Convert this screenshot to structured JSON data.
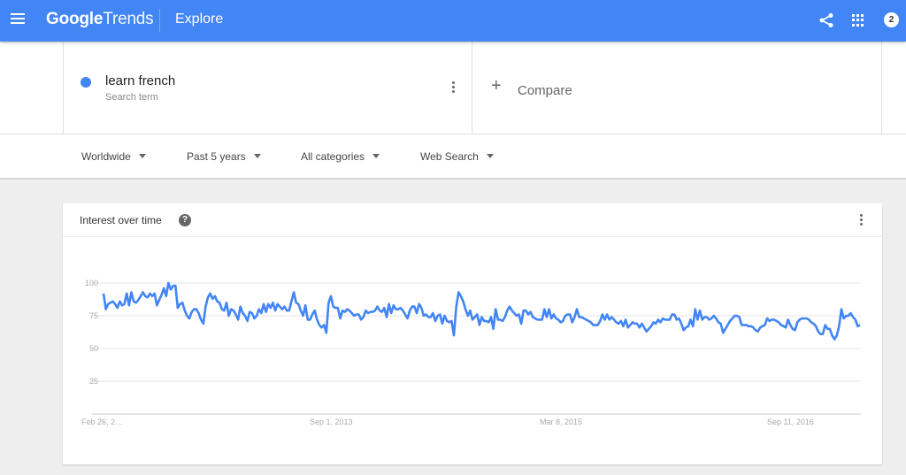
{
  "header": {
    "logo_google": "Google",
    "logo_trends": "Trends",
    "section": "Explore",
    "notification_count": "2",
    "icons": [
      "menu-icon",
      "share-icon",
      "apps-icon"
    ]
  },
  "search": {
    "term": "learn french",
    "term_type": "Search term",
    "term_color": "#4285f4",
    "compare_plus": "+",
    "compare_label": "Compare"
  },
  "filters": {
    "location": "Worldwide",
    "time_range": "Past 5 years",
    "category": "All categories",
    "search_type": "Web Search"
  },
  "card": {
    "title": "Interest over time",
    "help": "?"
  },
  "chart_data": {
    "type": "line",
    "title": "Interest over time",
    "xlabel": "",
    "ylabel": "",
    "ylim": [
      0,
      100
    ],
    "yticks": [
      25,
      50,
      75,
      100
    ],
    "ytick_labels": [
      "25",
      "50",
      "75",
      "100"
    ],
    "xtick_labels": [
      "Feb 26, 2…",
      "Sep 1, 2013",
      "Mar 8, 2015",
      "Sep 11, 2016"
    ],
    "xtick_positions": [
      0,
      0.3,
      0.6,
      0.9
    ],
    "grid": true,
    "legend": "none",
    "series": [
      {
        "name": "learn french",
        "color": "#4285f4",
        "values": [
          92,
          80,
          84,
          85,
          86,
          84,
          81,
          86,
          83,
          84,
          92,
          83,
          93,
          86,
          85,
          87,
          90,
          93,
          90,
          89,
          92,
          90,
          92,
          83,
          87,
          91,
          96,
          90,
          100,
          95,
          98,
          98,
          81,
          84,
          85,
          79,
          75,
          73,
          78,
          80,
          80,
          77,
          72,
          69,
          82,
          89,
          92,
          88,
          90,
          86,
          85,
          80,
          79,
          85,
          75,
          80,
          79,
          76,
          72,
          82,
          77,
          75,
          71,
          78,
          77,
          73,
          75,
          80,
          77,
          84,
          78,
          84,
          81,
          85,
          79,
          84,
          82,
          80,
          82,
          79,
          79,
          86,
          93,
          85,
          84,
          79,
          75,
          83,
          72,
          72,
          76,
          79,
          72,
          68,
          66,
          68,
          62,
          85,
          90,
          82,
          81,
          81,
          73,
          79,
          78,
          80,
          79,
          77,
          75,
          76,
          76,
          72,
          74,
          79,
          77,
          78,
          78,
          79,
          82,
          79,
          78,
          81,
          74,
          84,
          77,
          83,
          80,
          80,
          81,
          79,
          76,
          73,
          79,
          82,
          82,
          77,
          84,
          81,
          75,
          76,
          74,
          74,
          77,
          71,
          75,
          76,
          69,
          75,
          71,
          70,
          71,
          60,
          82,
          93,
          90,
          86,
          80,
          75,
          79,
          72,
          74,
          76,
          68,
          74,
          71,
          71,
          70,
          74,
          65,
          80,
          72,
          72,
          71,
          74,
          79,
          82,
          79,
          77,
          75,
          76,
          69,
          79,
          79,
          76,
          78,
          74,
          73,
          72,
          72,
          72,
          80,
          74,
          80,
          73,
          76,
          73,
          72,
          70,
          71,
          75,
          76,
          76,
          70,
          74,
          80,
          74,
          74,
          73,
          72,
          71,
          70,
          68,
          68,
          68,
          71,
          76,
          72,
          76,
          72,
          74,
          72,
          70,
          69,
          71,
          67,
          72,
          66,
          68,
          70,
          69,
          69,
          66,
          69,
          66,
          63,
          65,
          67,
          70,
          69,
          72,
          70,
          73,
          72,
          72,
          72,
          76,
          76,
          72,
          73,
          69,
          64,
          66,
          67,
          72,
          67,
          80,
          72,
          79,
          72,
          74,
          74,
          72,
          73,
          75,
          73,
          70,
          69,
          62,
          65,
          68,
          71,
          73,
          75,
          75,
          74,
          68,
          68,
          68,
          67,
          67,
          66,
          64,
          63,
          66,
          67,
          68,
          73,
          71,
          72,
          72,
          71,
          70,
          68,
          67,
          66,
          72,
          68,
          65,
          64,
          70,
          72,
          73,
          73,
          73,
          72,
          70,
          69,
          67,
          63,
          61,
          61,
          68,
          65,
          65,
          60,
          57,
          60,
          67,
          80,
          73,
          75,
          75,
          77,
          74,
          72,
          67,
          68
        ]
      }
    ]
  }
}
